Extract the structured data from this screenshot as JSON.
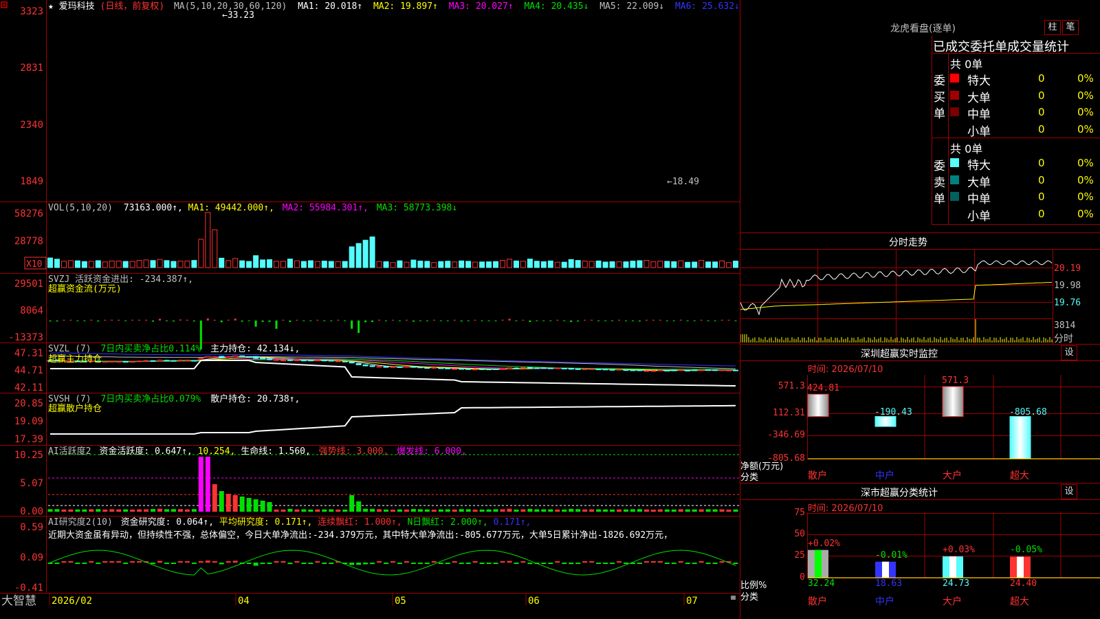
{
  "colors": {
    "up": "#ff3232",
    "down": "#54fcfc",
    "border": "#a00000",
    "yellow": "#ffff00",
    "white": "#ffffff",
    "magenta": "#ff00ff",
    "green": "#00e000",
    "blue": "#3434ff",
    "gray": "#a0a0a0"
  },
  "stock": {
    "star": "★",
    "name": "爱玛科技",
    "period": "(日线，前复权)"
  },
  "main_panel": {
    "y_axis_labels": [
      "3323",
      "2831",
      "2340",
      "1849"
    ],
    "ma_title": "MA(5,10,20,30,60,120)",
    "ma_values": [
      {
        "label": "MA1: 20.018↑",
        "color": "#ffffff"
      },
      {
        "label": "MA2: 19.897↑",
        "color": "#ffff00"
      },
      {
        "label": "MA3: 20.027↑",
        "color": "#ff00ff"
      },
      {
        "label": "MA4: 20.435↓",
        "color": "#00e000"
      },
      {
        "label": "MA5: 22.009↓",
        "color": "#c0c0c0"
      },
      {
        "label": "MA6: 25.632↓",
        "color": "#3434ff"
      }
    ],
    "max_label": "←33.23",
    "min_label": "←18.49",
    "candle_rows": [
      [
        291,
        286,
        303,
        282
      ],
      [
        293,
        288,
        299,
        283
      ],
      [
        289,
        290,
        294,
        284
      ],
      [
        287,
        289,
        295,
        283
      ],
      [
        285,
        283,
        290,
        279
      ],
      [
        284,
        282,
        285,
        277
      ],
      [
        282,
        286,
        289,
        281
      ],
      [
        283,
        278,
        285,
        275
      ],
      [
        280,
        281,
        284,
        277
      ],
      [
        279,
        283,
        286,
        277
      ],
      [
        280,
        282,
        286,
        276
      ],
      [
        282,
        279,
        285,
        277
      ],
      [
        281,
        282,
        286,
        277
      ],
      [
        283,
        286,
        292,
        280
      ],
      [
        287,
        290,
        296,
        282
      ],
      [
        289,
        283,
        291,
        281
      ],
      [
        285,
        294,
        297,
        284
      ],
      [
        292,
        288,
        297,
        286
      ],
      [
        290,
        285,
        292,
        285
      ],
      [
        289,
        294,
        296,
        288
      ],
      [
        292,
        294,
        299,
        289
      ],
      [
        291,
        286,
        294,
        283
      ],
      [
        310,
        310,
        314,
        307
      ],
      [
        315,
        326,
        330,
        313
      ],
      [
        320,
        323,
        328,
        315
      ],
      [
        327,
        318,
        329,
        311
      ],
      [
        319,
        323,
        328,
        317
      ],
      [
        322,
        332,
        336,
        320
      ],
      [
        331,
        325,
        333,
        324
      ],
      [
        325,
        322,
        326,
        318
      ],
      [
        326,
        309,
        328,
        304
      ],
      [
        312,
        305,
        313,
        301
      ],
      [
        304,
        297,
        305,
        292
      ],
      [
        296,
        297,
        302,
        292
      ],
      [
        292,
        293,
        299,
        289
      ],
      [
        298,
        290,
        300,
        285
      ],
      [
        292,
        294,
        296,
        285
      ],
      [
        293,
        290,
        295,
        287
      ],
      [
        293,
        292,
        297,
        285
      ],
      [
        291,
        293,
        298,
        290
      ],
      [
        293,
        291,
        296,
        286
      ],
      [
        291,
        288,
        293,
        285
      ],
      [
        285,
        286,
        290,
        282
      ],
      [
        284,
        283,
        288,
        279
      ],
      [
        282,
        269,
        284,
        265
      ],
      [
        265,
        253,
        268,
        250
      ],
      [
        253,
        244,
        256,
        240
      ],
      [
        246,
        238,
        249,
        234
      ],
      [
        235,
        239,
        242,
        235
      ],
      [
        237,
        236,
        240,
        232
      ],
      [
        236,
        236,
        238,
        233
      ],
      [
        235,
        233,
        239,
        228
      ],
      [
        237,
        238,
        238,
        232
      ],
      [
        237,
        231,
        240,
        228
      ],
      [
        233,
        229,
        235,
        226
      ],
      [
        228,
        226,
        232,
        223
      ],
      [
        229,
        229,
        230,
        225
      ],
      [
        226,
        224,
        228,
        220
      ],
      [
        224,
        221,
        226,
        217
      ],
      [
        218,
        219,
        224,
        217
      ],
      [
        220,
        215,
        221,
        212
      ],
      [
        218,
        214,
        219,
        211
      ],
      [
        215,
        215,
        220,
        213
      ],
      [
        217,
        216,
        221,
        214
      ],
      [
        216,
        214,
        218,
        211
      ],
      [
        217,
        213,
        219,
        212
      ],
      [
        214,
        218,
        223,
        211
      ],
      [
        219,
        228,
        231,
        217
      ],
      [
        225,
        224,
        233,
        222
      ],
      [
        226,
        229,
        233,
        224
      ],
      [
        231,
        223,
        235,
        220
      ],
      [
        226,
        223,
        230,
        221
      ],
      [
        228,
        225,
        231,
        224
      ],
      [
        225,
        222,
        227,
        217
      ],
      [
        224,
        225,
        227,
        221
      ],
      [
        223,
        222,
        224,
        218
      ],
      [
        223,
        215,
        224,
        211
      ],
      [
        218,
        213,
        221,
        210
      ],
      [
        215,
        217,
        222,
        212
      ],
      [
        215,
        218,
        221,
        213
      ],
      [
        216,
        213,
        219,
        209
      ],
      [
        215,
        213,
        216,
        210
      ],
      [
        212,
        211,
        214,
        206
      ],
      [
        211,
        213,
        216,
        209
      ],
      [
        210,
        208,
        212,
        205
      ],
      [
        208,
        204,
        211,
        202
      ],
      [
        208,
        203,
        210,
        200
      ],
      [
        200,
        202,
        209,
        196
      ],
      [
        202,
        202,
        207,
        199
      ],
      [
        204,
        207,
        211,
        202
      ],
      [
        205,
        203,
        208,
        199
      ],
      [
        207,
        206,
        208,
        200
      ],
      [
        205,
        209,
        210,
        200
      ],
      [
        205,
        203,
        207,
        202
      ],
      [
        208,
        206,
        208,
        202
      ],
      [
        205,
        208,
        211,
        199
      ],
      [
        210,
        207,
        211,
        205
      ],
      [
        209,
        206,
        211,
        205
      ],
      [
        205,
        208,
        211,
        201
      ],
      [
        206,
        206,
        207,
        202
      ],
      [
        207,
        205,
        210,
        200
      ]
    ]
  },
  "vol_panel": {
    "title": "VOL(5,10,20)",
    "value": "73163.000↑,",
    "ma": [
      {
        "label": "MA1: 49442.000↑,",
        "color": "#ffff00"
      },
      {
        "label": "MA2: 55984.301↑,",
        "color": "#ff00ff"
      },
      {
        "label": "MA3: 58773.398↓",
        "color": "#00e000"
      }
    ],
    "y_axis_labels": [
      "58276",
      "28778"
    ],
    "unit": "X10"
  },
  "svzj_panel": {
    "title": "SVZJ  活跃资金进出: -234.387↑,",
    "subtitle": "超赢资金流(万元)",
    "y_axis_labels": [
      "29501",
      "8064",
      "-13373"
    ]
  },
  "svzl_panel": {
    "title_a": "SVZL (7)",
    "title_b": "7日内买卖净占比0.114%",
    "title_c": "主力持仓: 42.134↓,",
    "subtitle": "超赢主力持仓",
    "y_axis_labels": [
      "47.31",
      "44.71",
      "42.11"
    ]
  },
  "svsh_panel": {
    "title_a": "SVSH (7)",
    "title_b": "7日内买卖净占比0.079%",
    "title_c": "散户持仓: 20.738↑,",
    "subtitle": "超赢散户持仓",
    "y_axis_labels": [
      "20.85",
      "19.09",
      "17.39"
    ]
  },
  "ai_act_panel": {
    "title": "AI活跃度2",
    "a": "资金活跃度: 0.647↑,",
    "b": "10.254,",
    "c": "生命线: 1.560,",
    "d": "强势线: 3.000,",
    "e": "爆发线: 6.000,",
    "y_axis_labels": [
      "10.25",
      "5.07",
      "0.00"
    ]
  },
  "ai_res_panel": {
    "title": "AI研究度2(10)",
    "a": "资金研究度: 0.064↑,",
    "b": "平均研究度: 0.171↑,",
    "c": "连续飘红: 1.000↑,",
    "d": "N日飘红: 2.000↑,",
    "e": "0.171↑,",
    "commentary": "近期大资金虽有异动，但持续性不强，总体偏空，今日大单净流出:-234.379万元，其中特大单净流出:-805.677万元，大单5日累计净出-1826.692万元，",
    "y_axis_labels": [
      "0.59",
      "0.09",
      "-0.41"
    ]
  },
  "date_axis": {
    "brand": "大智慧",
    "labels": [
      "2026/02",
      "04",
      "05",
      "06",
      "07"
    ]
  },
  "right": {
    "lhb_title": "龙虎看盘(逐单)",
    "btn_bar": "柱",
    "btn_stroke": "笔",
    "stats_title": "已成交委托单成交量统计",
    "buy_label": "委买单",
    "sell_label": "委卖单",
    "buy_total": "共 0单",
    "sell_total": "共 0单",
    "rows": [
      {
        "name": "特大",
        "count": "0",
        "pct": "0%"
      },
      {
        "name": "大单",
        "count": "0",
        "pct": "0%"
      },
      {
        "name": "中单",
        "count": "0",
        "pct": "0%"
      },
      {
        "name": "小单",
        "count": "0",
        "pct": "0%"
      }
    ],
    "buy_colors": [
      "#ff0000",
      "#a00000",
      "#780000",
      "#000000"
    ],
    "sell_colors": [
      "#54fcfc",
      "#008080",
      "#006060",
      "#000000"
    ],
    "intraday_title": "分时走势",
    "intraday_prices": [
      "20.19",
      "19.98",
      "19.76"
    ],
    "intraday_vol": "3814",
    "intraday_label": "分时",
    "monitor": {
      "title": "深圳超赢实时监控",
      "settings": "设",
      "time": "时间: 2026/07/10",
      "y_axis_labels": [
        "571.3",
        "112.31",
        "-346.69",
        "-805.68"
      ],
      "y_unit": "净额(万元)",
      "x_unit": "分类",
      "categories": [
        "散户",
        "中户",
        "大户",
        "超大"
      ],
      "values": [
        424.81,
        -190.43,
        571.3,
        -805.68
      ],
      "value_labels": [
        "424.81",
        "-190.43",
        "571.3",
        "-805.68"
      ]
    },
    "classify": {
      "title": "深市超赢分类统计",
      "settings": "设",
      "time": "时间: 2026/07/10",
      "y_axis_labels": [
        "75",
        "50",
        "25",
        "0"
      ],
      "y_unit": "比例%",
      "x_unit": "分类",
      "categories": [
        "散户",
        "中户",
        "大户",
        "超大"
      ],
      "values": [
        32.24,
        18.63,
        24.73,
        24.4
      ],
      "value_labels": [
        "32.24",
        "18.63",
        "24.73",
        "24.40"
      ],
      "changes": [
        "+0.02%",
        "-0.01%",
        "+0.03%",
        "-0.05%"
      ]
    }
  }
}
